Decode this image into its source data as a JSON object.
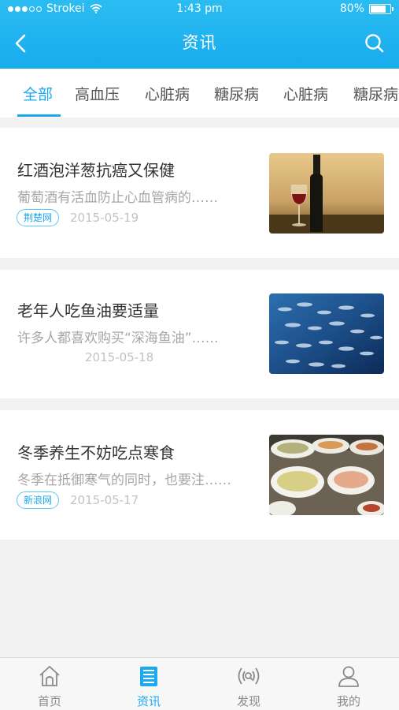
{
  "status_bar": {
    "carrier": "Strokei",
    "time": "1:43 pm",
    "battery": "80%",
    "battery_level": 0.8
  },
  "header": {
    "title": "资讯"
  },
  "category_tabs": [
    {
      "label": "全部",
      "active": true
    },
    {
      "label": "高血压",
      "active": false
    },
    {
      "label": "心脏病",
      "active": false
    },
    {
      "label": "糖尿病",
      "active": false
    },
    {
      "label": "心脏病",
      "active": false
    },
    {
      "label": "糖尿病",
      "active": false
    }
  ],
  "articles": [
    {
      "title": "红酒泡洋葱抗癌又保健",
      "summary": "葡萄酒有活血防止心血管病的……",
      "source": "荆楚网",
      "date": "2015-05-19",
      "thumbnail": "wine-glass-and-bottle"
    },
    {
      "title": "老年人吃鱼油要适量",
      "summary": "许多人都喜欢购买“深海鱼油”……",
      "source": "",
      "date": "2015-05-18",
      "thumbnail": "school-of-fish"
    },
    {
      "title": "冬季养生不妨吃点寒食",
      "summary": "冬季在抵御寒气的同时，也要注……",
      "source": "新浪网",
      "date": "2015-05-17",
      "thumbnail": "dishes-of-food"
    }
  ],
  "bottom_tabs": [
    {
      "label": "首页",
      "icon": "home-icon",
      "active": false
    },
    {
      "label": "资讯",
      "icon": "news-icon",
      "active": true
    },
    {
      "label": "发现",
      "icon": "discover-icon",
      "active": false
    },
    {
      "label": "我的",
      "icon": "profile-icon",
      "active": false
    }
  ],
  "colors": {
    "accent": "#19aaf0",
    "header_bg": "#1fb1ef"
  }
}
